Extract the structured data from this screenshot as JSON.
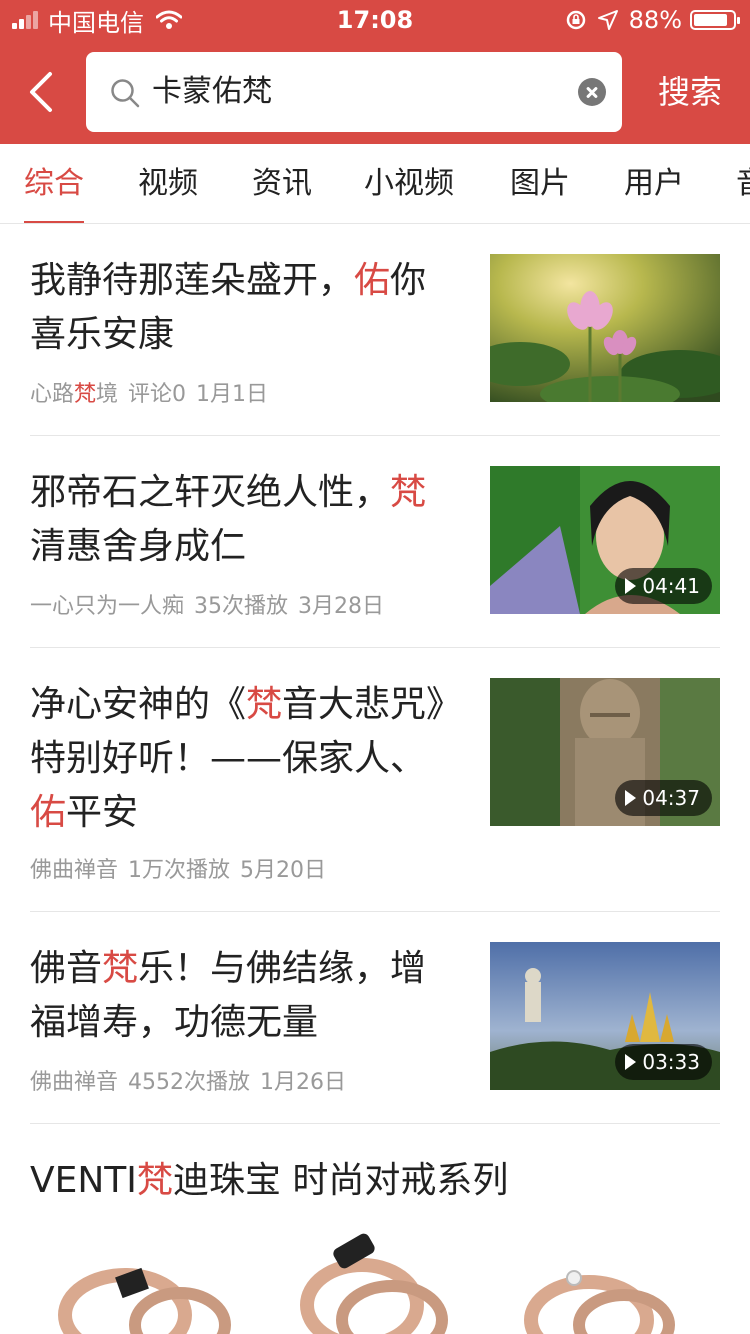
{
  "status_bar": {
    "carrier": "中国电信",
    "time": "17:08",
    "battery": "88%",
    "battery_level": 0.88
  },
  "search": {
    "query": "卡蒙佑梵",
    "button_label": "搜索"
  },
  "tabs": [
    "综合",
    "视频",
    "资讯",
    "小视频",
    "图片",
    "用户",
    "音"
  ],
  "feed": [
    {
      "title_parts": [
        "我静待那莲朵盛开，",
        "佑",
        "你喜乐安康"
      ],
      "meta": {
        "source_a": "心路",
        "source_hl": "梵",
        "source_b": "境",
        "stat": "评论0",
        "date": "1月1日"
      }
    },
    {
      "title_parts": [
        "邪帝石之轩灭绝人性，",
        "梵",
        "清惠舍身成仁"
      ],
      "meta": {
        "source": "一心只为一人痴",
        "stat": "35次播放",
        "date": "3月28日"
      },
      "duration": "04:41"
    },
    {
      "title_parts": [
        "净心安神的《",
        "梵",
        "音大悲咒》特别好听！——保家人、",
        "佑",
        "平安"
      ],
      "meta": {
        "source": "佛曲禅音",
        "stat": "1万次播放",
        "date": "5月20日"
      },
      "duration": "04:37"
    },
    {
      "title_parts": [
        "佛音",
        "梵",
        "乐！与佛结缘，增福增寿，功德无量"
      ],
      "meta": {
        "source": "佛曲禅音",
        "stat": "4552次播放",
        "date": "1月26日"
      },
      "duration": "03:33"
    }
  ],
  "ad": {
    "title_a": "VENTI",
    "title_hl": "梵",
    "title_b": "迪珠宝 时尚对戒系列"
  },
  "colors": {
    "brand": "#d84a44",
    "meta_gray": "#999999"
  },
  "icons": [
    "signal-icon",
    "wifi-icon",
    "lock-rotation-icon",
    "location-icon",
    "battery-icon",
    "back-icon",
    "search-icon",
    "clear-icon",
    "play-icon"
  ]
}
